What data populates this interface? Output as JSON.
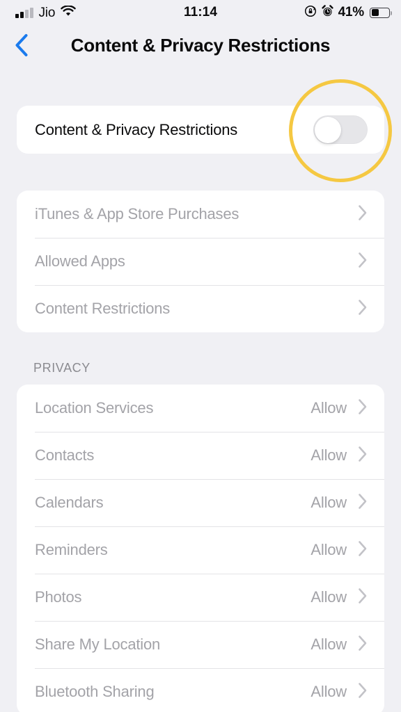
{
  "status_bar": {
    "carrier": "Jio",
    "wifi_icon": "wifi-icon",
    "time": "11:14",
    "rotation_lock_icon": "rotation-lock-icon",
    "alarm_icon": "alarm-clock-icon",
    "battery_percent": "41%",
    "battery_level": 41
  },
  "nav": {
    "back_icon": "chevron-left-icon",
    "title": "Content & Privacy Restrictions"
  },
  "toggle_section": {
    "label": "Content & Privacy Restrictions",
    "enabled": false,
    "state_text": "Off"
  },
  "restrictions_section": {
    "rows": [
      {
        "label": "iTunes & App Store Purchases",
        "value": "",
        "chevron": "chevron-right-icon"
      },
      {
        "label": "Allowed Apps",
        "value": "",
        "chevron": "chevron-right-icon"
      },
      {
        "label": "Content Restrictions",
        "value": "",
        "chevron": "chevron-right-icon"
      }
    ]
  },
  "privacy_section": {
    "header": "PRIVACY",
    "rows": [
      {
        "label": "Location Services",
        "value": "Allow",
        "chevron": "chevron-right-icon"
      },
      {
        "label": "Contacts",
        "value": "Allow",
        "chevron": "chevron-right-icon"
      },
      {
        "label": "Calendars",
        "value": "Allow",
        "chevron": "chevron-right-icon"
      },
      {
        "label": "Reminders",
        "value": "Allow",
        "chevron": "chevron-right-icon"
      },
      {
        "label": "Photos",
        "value": "Allow",
        "chevron": "chevron-right-icon"
      },
      {
        "label": "Share My Location",
        "value": "Allow",
        "chevron": "chevron-right-icon"
      },
      {
        "label": "Bluetooth Sharing",
        "value": "Allow",
        "chevron": "chevron-right-icon"
      }
    ]
  },
  "annotation": {
    "highlight_target": "content-privacy-restrictions-toggle",
    "highlight_color": "#f5c842"
  },
  "colors": {
    "background": "#f0f0f4",
    "card": "#ffffff",
    "accent_blue": "#1a7aed",
    "disabled_text": "#a3a3a8",
    "primary_text": "#0a0a0b",
    "separator": "#e3e3e6",
    "switch_off_track": "#e6e6e9"
  }
}
